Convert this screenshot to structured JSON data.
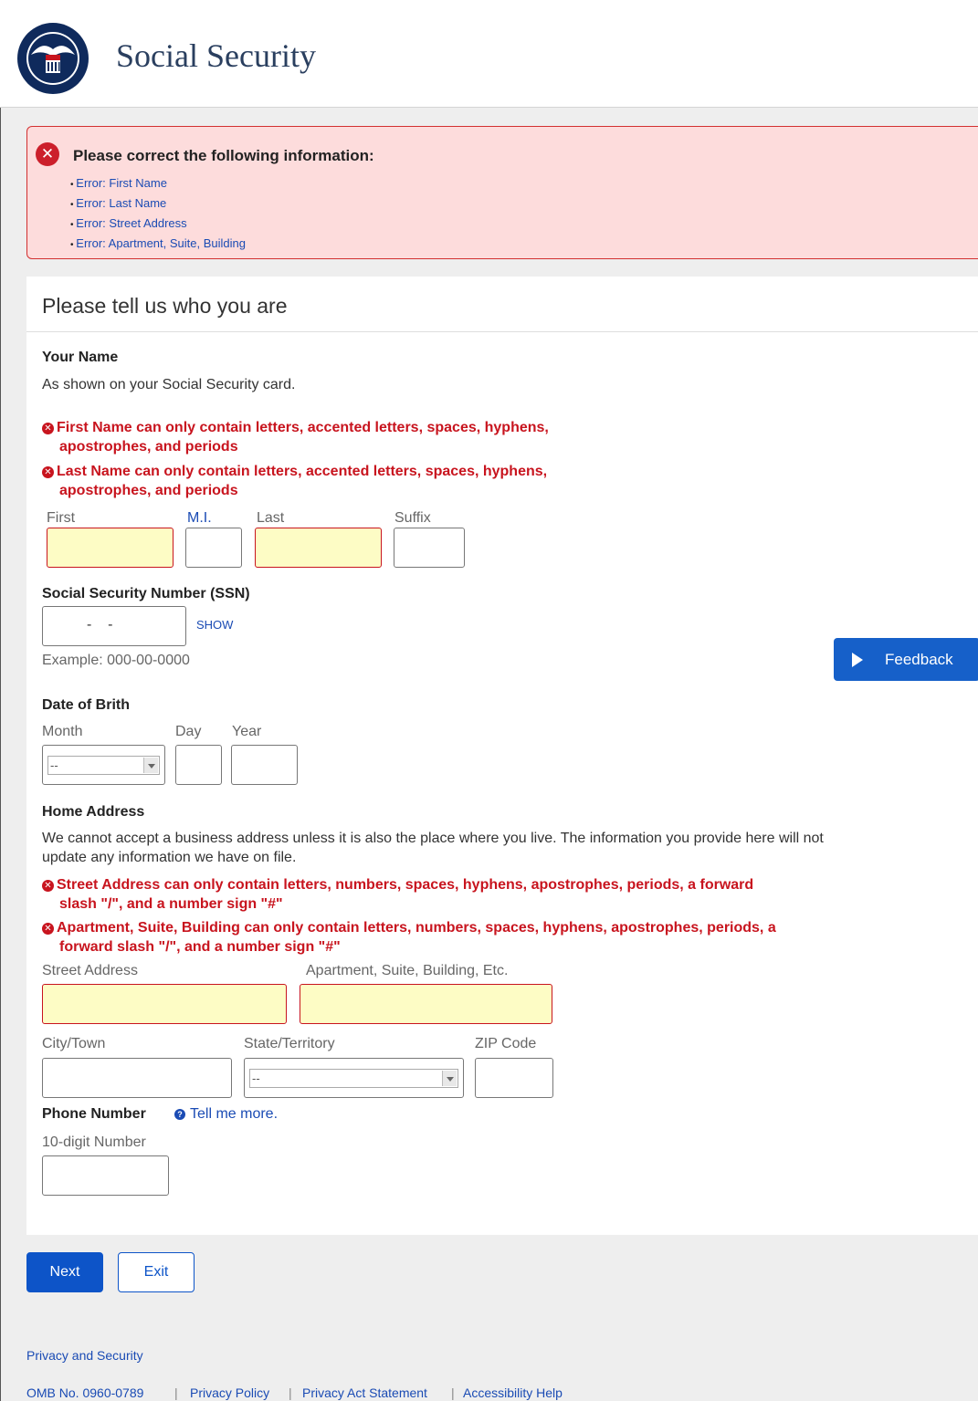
{
  "header": {
    "brand": "Social Security",
    "logo_text": "SOCIAL SECURITY ADMINISTRATION USA"
  },
  "error_summary": {
    "title": "Please correct the following information:",
    "items": [
      "Error: First Name",
      "Error: Last Name",
      "Error: Street Address",
      "Error: Apartment, Suite, Building"
    ]
  },
  "form": {
    "title": "Please tell us who you are",
    "name": {
      "heading": "Your Name",
      "hint": "As shown on your Social Security card.",
      "error_first_1": "First Name can only contain letters, accented letters, spaces, hyphens,",
      "error_first_2": "apostrophes, and periods",
      "error_last_1": "Last Name can only contain letters, accented letters, spaces, hyphens,",
      "error_last_2": "apostrophes, and periods",
      "first_label": "First",
      "mi_label": "M.I.",
      "last_label": "Last",
      "suffix_label": "Suffix"
    },
    "ssn": {
      "heading": "Social Security Number (SSN)",
      "value": "-    -",
      "show_label": "SHOW",
      "example": "Example: 000-00-0000"
    },
    "dob": {
      "heading": "Date of Brith",
      "month_label": "Month",
      "day_label": "Day",
      "year_label": "Year",
      "month_value": "--"
    },
    "address": {
      "heading": "Home Address",
      "hint_1": "We cannot accept a business address unless it is also the place where you live. The information you provide here will not",
      "hint_2": "update any information we have on file.",
      "error_street_1": "Street Address can only contain letters, numbers, spaces, hyphens, apostrophes, periods, a forward",
      "error_street_2": "slash \"/\", and a number sign \"#\"",
      "error_apt_1": "Apartment, Suite, Building can only contain letters, numbers, spaces, hyphens, apostrophes, periods, a",
      "error_apt_2": "forward slash \"/\", and a number sign \"#\"",
      "street_label": "Street Address",
      "apt_label": "Apartment, Suite, Building, Etc.",
      "city_label": "City/Town",
      "state_label": "State/Territory",
      "state_value": "--",
      "zip_label": "ZIP Code"
    },
    "phone": {
      "heading": "Phone Number",
      "tell_more": "Tell me more.",
      "label": "10-digit Number"
    }
  },
  "feedback_label": "Feedback",
  "buttons": {
    "next": "Next",
    "exit": "Exit"
  },
  "footer": {
    "privacy_security": "Privacy and Security",
    "omb": "OMB No. 0960-0789",
    "privacy_policy": "Privacy Policy",
    "privacy_act": "Privacy Act Statement",
    "accessibility": "Accessibility Help",
    "separator": "|"
  },
  "colors": {
    "brand": "#2a3f5f",
    "error": "#c8141e",
    "link": "#1a4bb4",
    "primary": "#0d54c8"
  }
}
